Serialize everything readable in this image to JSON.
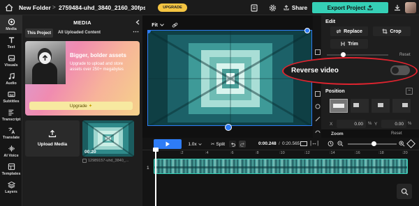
{
  "topbar": {
    "folder": "New Folder",
    "sep": ">",
    "project": "2759484-uhd_3840_2160_30fps",
    "upgrade": "UPGRADE",
    "share": "Share",
    "export": "Export Project"
  },
  "rail": [
    {
      "label": "Media",
      "icon": "media-icon"
    },
    {
      "label": "Text",
      "icon": "text-icon"
    },
    {
      "label": "Visuals",
      "icon": "visuals-icon"
    },
    {
      "label": "Audio",
      "icon": "audio-icon"
    },
    {
      "label": "Subtitles",
      "icon": "subtitles-icon"
    },
    {
      "label": "Transcript",
      "icon": "transcript-icon"
    },
    {
      "label": "Translate",
      "icon": "translate-icon"
    },
    {
      "label": "AI Voice",
      "icon": "ai-voice-icon"
    },
    {
      "label": "Templates",
      "icon": "templates-icon"
    },
    {
      "label": "Layers",
      "icon": "layers-icon"
    }
  ],
  "media": {
    "title": "MEDIA",
    "tab_project": "This Project",
    "tab_all": "All Uploaded Content",
    "promo_title": "Bigger, bolder assets",
    "promo_text": "Upgrade to upload and store assets over 250+ megabytes",
    "promo_button": "Upgrade",
    "upload": "Upload Media",
    "clip_duration": "00:20",
    "clip_name": "12989157-uhd_3840_..."
  },
  "canvas": {
    "fit": "Fit"
  },
  "edit": {
    "title": "Edit",
    "replace": "Replace",
    "crop": "Crop",
    "trim": "Trim",
    "reset1": "Reset",
    "reverse": "Reverse video",
    "position": "Position",
    "x_label": "X",
    "x_value": "0.00",
    "x_unit": "%",
    "y_label": "Y",
    "y_value": "0.00",
    "y_unit": "%",
    "zoom": "Zoom",
    "reset2": "Reset"
  },
  "timeline": {
    "speed": "1.0x",
    "split": "Split",
    "current": "0:00.248",
    "sep": "/",
    "total": "0:20.565",
    "ticks": [
      ":2",
      ":4",
      ":6",
      ":8",
      ":10",
      ":12",
      ":14",
      ":16",
      ":18",
      ":20"
    ],
    "track_no": "1"
  },
  "colors": {
    "accent": "#2e7cf6",
    "export": "#35d0b6",
    "upgrade": "#f5c542",
    "highlight": "#e0242f"
  }
}
